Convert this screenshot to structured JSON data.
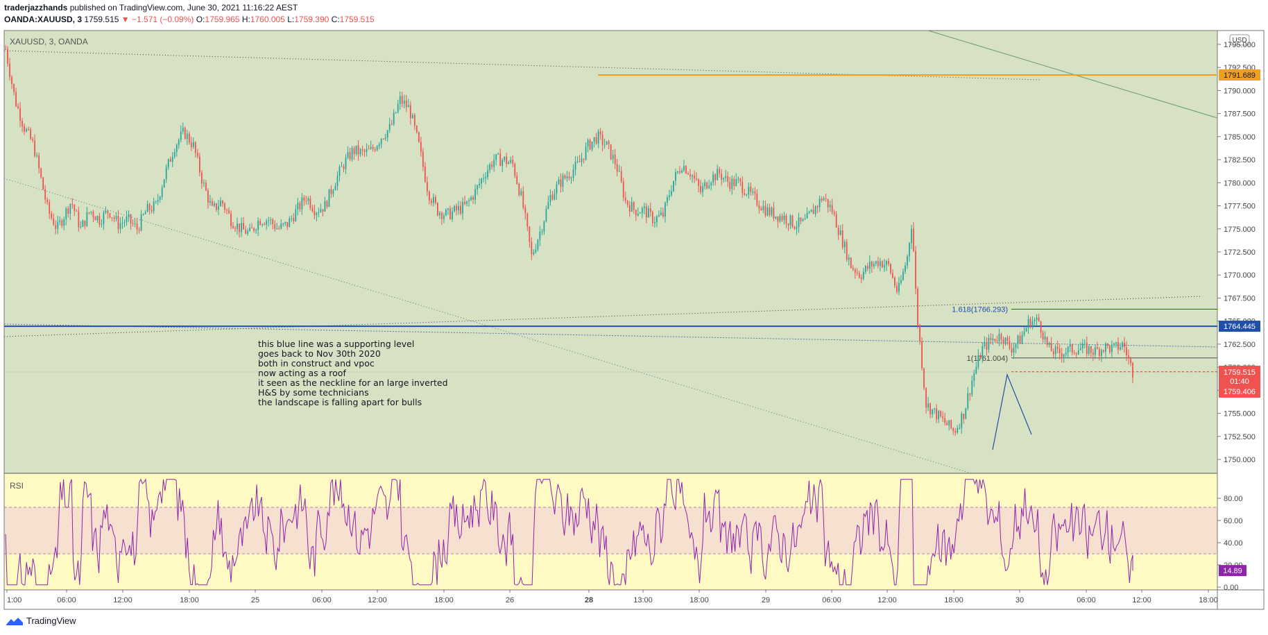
{
  "header": {
    "author": "traderjazzhands",
    "published_text": "published on TradingView.com, June 30, 2021 11:16:22 AEST",
    "symbol": "OANDA:XAUUSD, 3",
    "last": "1759.515",
    "change": "−1.571 (−0.09%)",
    "o_label": "O:",
    "o": "1759.965",
    "h_label": "H:",
    "h": "1760.005",
    "l_label": "L:",
    "l": "1759.390",
    "c_label": "C:",
    "c": "1759.515"
  },
  "pane_label": "XAUUSD, 3, OANDA",
  "currency": "USD",
  "rsi_label": "RSI",
  "annotation_lines": [
    "this blue line was a supporting level",
    "goes back to Nov 30th 2020",
    "both in construct and vpoc",
    "now acting as a roof",
    "it seen as the neckline for an large inverted",
    "H&S by some technicians",
    "the landscape is falling apart for bulls"
  ],
  "fib_labels": [
    "1.618(1766.293)",
    "1(1761.004)"
  ],
  "price_tags": {
    "orange": "1791.689",
    "blue": "1764.445",
    "last": "1759.515",
    "countdown": "01:40",
    "bid": "1759.406",
    "rsi": "14.89"
  },
  "footer": {
    "brand": "TradingView"
  },
  "colors": {
    "price_bg": "#d7e2c4",
    "rsi_bg": "#fff9c4",
    "rsi_band": "#f6e0d0",
    "up": "#26a69a",
    "down": "#ef5350",
    "orange": "#f0a020",
    "blue": "#1f4fa8",
    "rsi_line": "#8e24aa"
  },
  "chart_data": {
    "type": "candlestick",
    "price_axis": {
      "ylim": [
        1748.5,
        1796.5
      ],
      "ticks": [
        "1795.000",
        "1792.500",
        "1790.000",
        "1787.500",
        "1785.000",
        "1782.500",
        "1780.000",
        "1777.500",
        "1775.000",
        "1772.500",
        "1770.000",
        "1767.500",
        "1765.000",
        "1762.500",
        "1760.000",
        "1757.500",
        "1755.000",
        "1752.500",
        "1750.000"
      ]
    },
    "time_axis": {
      "ticks": [
        "1:00",
        "06:00",
        "12:00",
        "18:00",
        "25",
        "06:00",
        "12:00",
        "18:00",
        "26",
        "28",
        "13:00",
        "18:00",
        "29",
        "06:00",
        "12:00",
        "18:00",
        "30",
        "06:00",
        "12:00",
        "18:00"
      ],
      "bold": [
        "28"
      ]
    },
    "close_path": [
      [
        0,
        1794.5
      ],
      [
        4,
        1789
      ],
      [
        8,
        1786
      ],
      [
        12,
        1784
      ],
      [
        18,
        1777
      ],
      [
        22,
        1775
      ],
      [
        28,
        1778
      ],
      [
        32,
        1775
      ],
      [
        36,
        1777
      ],
      [
        40,
        1776
      ],
      [
        44,
        1777
      ],
      [
        48,
        1775.5
      ],
      [
        52,
        1776
      ],
      [
        56,
        1775
      ],
      [
        60,
        1777
      ],
      [
        64,
        1777.5
      ],
      [
        68,
        1781
      ],
      [
        72,
        1784
      ],
      [
        76,
        1785.5
      ],
      [
        80,
        1784
      ],
      [
        84,
        1780
      ],
      [
        88,
        1777
      ],
      [
        92,
        1778
      ],
      [
        96,
        1776
      ],
      [
        100,
        1775
      ],
      [
        104,
        1774.5
      ],
      [
        108,
        1776
      ],
      [
        112,
        1776
      ],
      [
        116,
        1775
      ],
      [
        120,
        1775.5
      ],
      [
        124,
        1777
      ],
      [
        128,
        1778.5
      ],
      [
        132,
        1777
      ],
      [
        136,
        1777.5
      ],
      [
        140,
        1780
      ],
      [
        144,
        1782
      ],
      [
        148,
        1783.5
      ],
      [
        152,
        1783.2
      ],
      [
        156,
        1783.5
      ],
      [
        160,
        1785
      ],
      [
        164,
        1786
      ],
      [
        168,
        1789
      ],
      [
        172,
        1788
      ],
      [
        176,
        1784
      ],
      [
        180,
        1779
      ],
      [
        184,
        1777
      ],
      [
        188,
        1776.5
      ],
      [
        192,
        1777
      ],
      [
        196,
        1777.5
      ],
      [
        200,
        1779
      ],
      [
        204,
        1781
      ],
      [
        208,
        1782.5
      ],
      [
        212,
        1782.5
      ],
      [
        216,
        1782
      ],
      [
        220,
        1778
      ],
      [
        224,
        1772
      ],
      [
        228,
        1775
      ],
      [
        232,
        1778.5
      ],
      [
        236,
        1780
      ],
      [
        240,
        1781
      ],
      [
        244,
        1782
      ],
      [
        248,
        1784
      ],
      [
        252,
        1785
      ],
      [
        256,
        1784
      ],
      [
        260,
        1782
      ],
      [
        264,
        1778
      ],
      [
        268,
        1777
      ],
      [
        272,
        1777
      ],
      [
        276,
        1776
      ],
      [
        280,
        1776.5
      ],
      [
        284,
        1780
      ],
      [
        288,
        1782
      ],
      [
        292,
        1781
      ],
      [
        296,
        1779
      ],
      [
        300,
        1780.5
      ],
      [
        304,
        1781
      ],
      [
        308,
        1780
      ],
      [
        312,
        1780
      ],
      [
        316,
        1779
      ],
      [
        320,
        1778
      ],
      [
        324,
        1777
      ],
      [
        328,
        1776.5
      ],
      [
        332,
        1776.2
      ],
      [
        336,
        1775.5
      ],
      [
        340,
        1775.6
      ],
      [
        344,
        1777
      ],
      [
        348,
        1778.5
      ],
      [
        352,
        1777
      ],
      [
        356,
        1774
      ],
      [
        360,
        1771
      ],
      [
        364,
        1770
      ],
      [
        368,
        1771
      ],
      [
        372,
        1771.5
      ],
      [
        376,
        1771
      ],
      [
        380,
        1768
      ],
      [
        384,
        1772
      ],
      [
        386,
        1776
      ],
      [
        388,
        1766
      ],
      [
        392,
        1756
      ],
      [
        396,
        1755
      ],
      [
        400,
        1754
      ],
      [
        404,
        1753
      ],
      [
        408,
        1755
      ],
      [
        412,
        1759
      ],
      [
        416,
        1762
      ],
      [
        420,
        1763
      ],
      [
        424,
        1763.5
      ],
      [
        428,
        1762
      ],
      [
        432,
        1763
      ],
      [
        436,
        1765
      ],
      [
        440,
        1765
      ],
      [
        444,
        1762
      ],
      [
        448,
        1761.5
      ],
      [
        452,
        1761.8
      ],
      [
        456,
        1762
      ],
      [
        460,
        1762
      ],
      [
        464,
        1761.7
      ],
      [
        468,
        1762.2
      ],
      [
        472,
        1762
      ],
      [
        476,
        1762.5
      ],
      [
        480,
        1759.5
      ]
    ],
    "lines": {
      "orange_horizontal": 1791.689,
      "blue_horizontal": 1764.445,
      "fib_1618": 1766.293,
      "fib_1": 1761.004,
      "last_price": 1759.515
    },
    "rsi": {
      "ylim": [
        0,
        100
      ],
      "ticks": [
        "80.00",
        "60.00",
        "40.00",
        "20.00",
        "0.00"
      ],
      "band": [
        30,
        70
      ],
      "last": 14.89
    }
  }
}
